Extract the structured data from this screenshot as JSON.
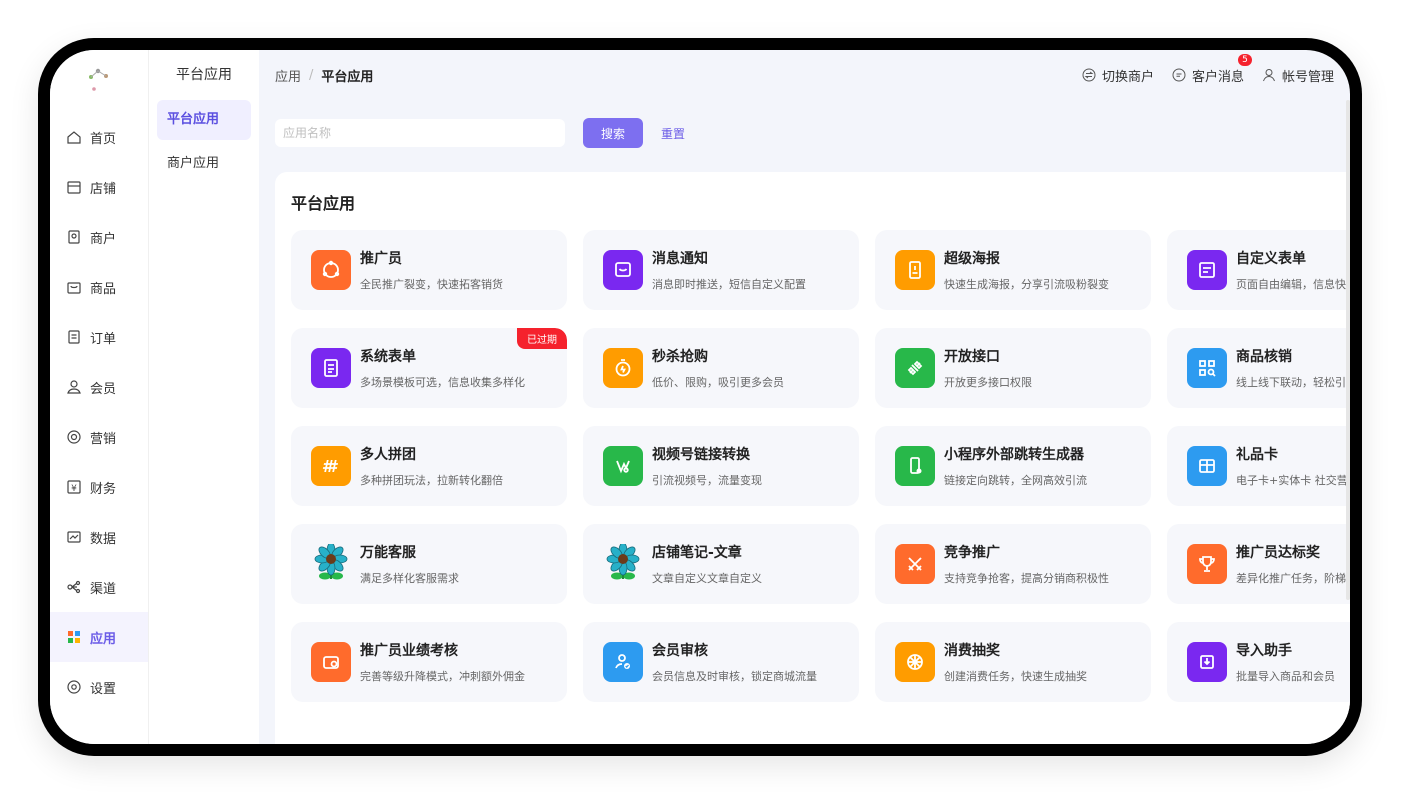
{
  "topbar": {
    "breadcrumb_root": "应用",
    "breadcrumb_current": "平台应用",
    "switch_merchant": "切换商户",
    "customer_messages": "客户消息",
    "message_count": "5",
    "account_manage": "帐号管理"
  },
  "sidebar": {
    "items": [
      {
        "label": "首页",
        "icon": "home-icon"
      },
      {
        "label": "店铺",
        "icon": "shop-icon"
      },
      {
        "label": "商户",
        "icon": "merchant-icon"
      },
      {
        "label": "商品",
        "icon": "goods-icon"
      },
      {
        "label": "订单",
        "icon": "order-icon"
      },
      {
        "label": "会员",
        "icon": "user-icon"
      },
      {
        "label": "营销",
        "icon": "marketing-icon"
      },
      {
        "label": "财务",
        "icon": "finance-icon"
      },
      {
        "label": "数据",
        "icon": "chart-icon"
      },
      {
        "label": "渠道",
        "icon": "channel-icon"
      },
      {
        "label": "应用",
        "icon": "apps-icon"
      },
      {
        "label": "设置",
        "icon": "settings-icon"
      }
    ],
    "active": "应用"
  },
  "subbar": {
    "title": "平台应用",
    "items": [
      "平台应用",
      "商户应用"
    ]
  },
  "search": {
    "placeholder": "应用名称",
    "search_label": "搜索",
    "reset_label": "重置"
  },
  "panel": {
    "title": "平台应用"
  },
  "apps": [
    {
      "name": "推广员",
      "desc": "全民推广裂变，快速拓客销货",
      "color": "#ff6b2c",
      "icon": "share-icon"
    },
    {
      "name": "消息通知",
      "desc": "消息即时推送，短信自定义配置",
      "color": "#7a28f0",
      "icon": "message-icon"
    },
    {
      "name": "超级海报",
      "desc": "快速生成海报，分享引流吸粉裂变",
      "color": "#ff9c00",
      "icon": "poster-icon"
    },
    {
      "name": "自定义表单",
      "desc": "页面自由编辑，信息快",
      "color": "#7a28f0",
      "icon": "form-icon"
    },
    {
      "name": "系统表单",
      "desc": "多场景模板可选，信息收集多样化",
      "color": "#7a28f0",
      "icon": "doc-icon",
      "tag": "已过期"
    },
    {
      "name": "秒杀抢购",
      "desc": "低价、限购，吸引更多会员",
      "color": "#ff9c00",
      "icon": "timer-icon"
    },
    {
      "name": "开放接口",
      "desc": "开放更多接口权限",
      "color": "#28b84a",
      "icon": "plug-icon"
    },
    {
      "name": "商品核销",
      "desc": "线上线下联动，轻松引",
      "color": "#2d9bf0",
      "icon": "qr-icon"
    },
    {
      "name": "多人拼团",
      "desc": "多种拼团玩法，拉新转化翻倍",
      "color": "#ff9c00",
      "icon": "group-icon"
    },
    {
      "name": "视频号链接转换",
      "desc": "引流视频号，流量变现",
      "color": "#28b84a",
      "icon": "video-icon"
    },
    {
      "name": "小程序外部跳转生成器",
      "desc": "链接定向跳转，全网高效引流",
      "color": "#28b84a",
      "icon": "mobile-link-icon"
    },
    {
      "name": "礼品卡",
      "desc": "电子卡+实体卡 社交营",
      "color": "#2d9bf0",
      "icon": "gift-card-icon"
    },
    {
      "name": "万能客服",
      "desc": "满足多样化客服需求",
      "color": "",
      "icon": "flower-icon"
    },
    {
      "name": "店铺笔记-文章",
      "desc": "文章自定义文章自定义",
      "color": "",
      "icon": "flower-icon"
    },
    {
      "name": "竞争推广",
      "desc": "支持竞争抢客，提高分销商积极性",
      "color": "#ff6b2c",
      "icon": "compete-icon"
    },
    {
      "name": "推广员达标奖",
      "desc": "差异化推广任务，阶梯",
      "color": "#ff6b2c",
      "icon": "trophy-icon"
    },
    {
      "name": "推广员业绩考核",
      "desc": "完善等级升降模式，冲刺额外佣金",
      "color": "#ff6b2c",
      "icon": "wallet-icon"
    },
    {
      "name": "会员审核",
      "desc": "会员信息及时审核，锁定商城流量",
      "color": "#2d9bf0",
      "icon": "user-check-icon"
    },
    {
      "name": "消费抽奖",
      "desc": "创建消费任务，快速生成抽奖",
      "color": "#ff9c00",
      "icon": "wheel-icon"
    },
    {
      "name": "导入助手",
      "desc": "批量导入商品和会员",
      "color": "#7a28f0",
      "icon": "import-icon"
    }
  ]
}
